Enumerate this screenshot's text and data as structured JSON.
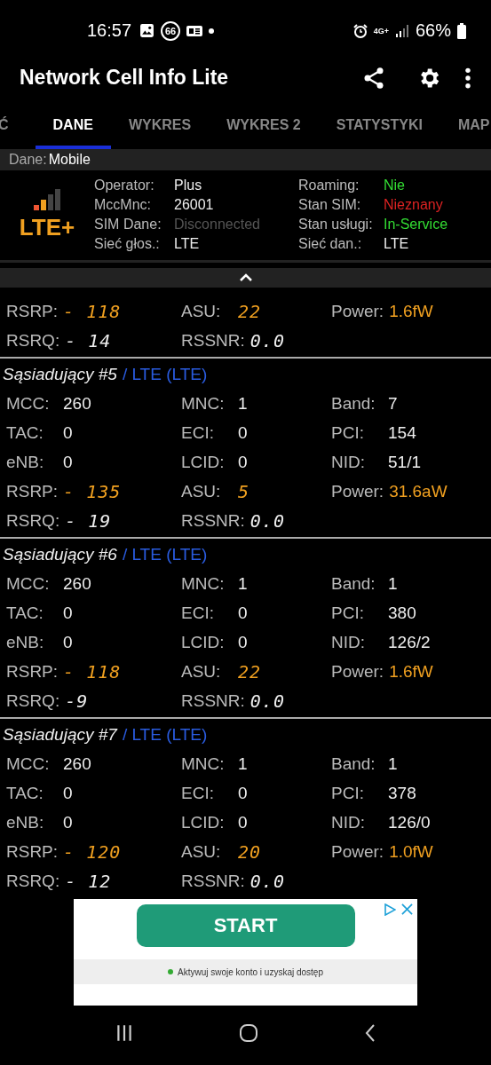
{
  "status_bar": {
    "time": "16:57",
    "badge": "66",
    "network": "4G+",
    "battery": "66%"
  },
  "app_bar": {
    "title": "Network Cell Info Lite"
  },
  "tabs": [
    {
      "label": "Ć",
      "selected": false
    },
    {
      "label": "DANE",
      "selected": true
    },
    {
      "label": "WYKRES",
      "selected": false
    },
    {
      "label": "WYKRES 2",
      "selected": false
    },
    {
      "label": "STATYSTYKI",
      "selected": false
    },
    {
      "label": "MAP",
      "selected": false
    }
  ],
  "data_source": {
    "label": "Dane:",
    "value": "Mobile"
  },
  "summary": {
    "technology": "LTE+",
    "signal": {
      "level": 0.5
    },
    "left": [
      {
        "label": "Operator:",
        "value": "Plus",
        "color": "#eeeeee"
      },
      {
        "label": "MccMnc:",
        "value": "26001",
        "color": "#eeeeee"
      },
      {
        "label": "SIM Dane:",
        "value": "Disconnected",
        "color": "#555555"
      },
      {
        "label": "Sieć głos.:",
        "value": "LTE",
        "color": "#eeeeee"
      }
    ],
    "right": [
      {
        "label": "Roaming:",
        "value": "Nie",
        "color": "#33dd33"
      },
      {
        "label": "Stan SIM:",
        "value": "Nieznany",
        "color": "#dd2222"
      },
      {
        "label": "Stan usługi:",
        "value": "In-Service",
        "color": "#33dd33"
      },
      {
        "label": "Sieć dan.:",
        "value": "LTE",
        "color": "#eeeeee"
      }
    ]
  },
  "cells": [
    {
      "rows": [
        [
          {
            "label": "RSRP:",
            "value": "- 118",
            "kind": "segment",
            "highlight": true
          },
          {
            "label": "ASU:",
            "value": "22",
            "kind": "segment",
            "highlight": true
          },
          {
            "label": "Power:",
            "value": "1.6fW",
            "kind": "power"
          }
        ],
        [
          {
            "label": "RSRQ:",
            "value": "- 14",
            "kind": "segment",
            "highlight": false
          },
          {
            "label": "RSSNR:",
            "value": "0.0",
            "kind": "segment",
            "highlight": false
          }
        ]
      ]
    },
    {
      "title": "Sąsiadujący #5",
      "tech": "/ LTE (LTE)",
      "rows": [
        [
          {
            "label": "MCC:",
            "value": "260",
            "kind": "text"
          },
          {
            "label": "MNC:",
            "value": "1",
            "kind": "text"
          },
          {
            "label": "Band:",
            "value": "7",
            "kind": "text"
          }
        ],
        [
          {
            "label": "TAC:",
            "value": "0",
            "kind": "text"
          },
          {
            "label": "ECI:",
            "value": "0",
            "kind": "text"
          },
          {
            "label": "PCI:",
            "value": "154",
            "kind": "text"
          }
        ],
        [
          {
            "label": "eNB:",
            "value": "0",
            "kind": "text"
          },
          {
            "label": "LCID:",
            "value": "0",
            "kind": "text"
          },
          {
            "label": "NID:",
            "value": "51/1",
            "kind": "text"
          }
        ],
        [
          {
            "label": "RSRP:",
            "value": "- 135",
            "kind": "segment",
            "highlight": true
          },
          {
            "label": "ASU:",
            "value": "5",
            "kind": "segment",
            "highlight": true
          },
          {
            "label": "Power:",
            "value": "31.6aW",
            "kind": "power"
          }
        ],
        [
          {
            "label": "RSRQ:",
            "value": "- 19",
            "kind": "segment",
            "highlight": false
          },
          {
            "label": "RSSNR:",
            "value": "0.0",
            "kind": "segment",
            "highlight": false
          }
        ]
      ]
    },
    {
      "title": "Sąsiadujący #6",
      "tech": "/ LTE (LTE)",
      "rows": [
        [
          {
            "label": "MCC:",
            "value": "260",
            "kind": "text"
          },
          {
            "label": "MNC:",
            "value": "1",
            "kind": "text"
          },
          {
            "label": "Band:",
            "value": "1",
            "kind": "text"
          }
        ],
        [
          {
            "label": "TAC:",
            "value": "0",
            "kind": "text"
          },
          {
            "label": "ECI:",
            "value": "0",
            "kind": "text"
          },
          {
            "label": "PCI:",
            "value": "380",
            "kind": "text"
          }
        ],
        [
          {
            "label": "eNB:",
            "value": "0",
            "kind": "text"
          },
          {
            "label": "LCID:",
            "value": "0",
            "kind": "text"
          },
          {
            "label": "NID:",
            "value": "126/2",
            "kind": "text"
          }
        ],
        [
          {
            "label": "RSRP:",
            "value": "- 118",
            "kind": "segment",
            "highlight": true
          },
          {
            "label": "ASU:",
            "value": "22",
            "kind": "segment",
            "highlight": true
          },
          {
            "label": "Power:",
            "value": "1.6fW",
            "kind": "power"
          }
        ],
        [
          {
            "label": "RSRQ:",
            "value": "-9",
            "kind": "segment",
            "highlight": false
          },
          {
            "label": "RSSNR:",
            "value": "0.0",
            "kind": "segment",
            "highlight": false
          }
        ]
      ]
    },
    {
      "title": "Sąsiadujący #7",
      "tech": "/ LTE (LTE)",
      "rows": [
        [
          {
            "label": "MCC:",
            "value": "260",
            "kind": "text"
          },
          {
            "label": "MNC:",
            "value": "1",
            "kind": "text"
          },
          {
            "label": "Band:",
            "value": "1",
            "kind": "text"
          }
        ],
        [
          {
            "label": "TAC:",
            "value": "0",
            "kind": "text"
          },
          {
            "label": "ECI:",
            "value": "0",
            "kind": "text"
          },
          {
            "label": "PCI:",
            "value": "378",
            "kind": "text"
          }
        ],
        [
          {
            "label": "eNB:",
            "value": "0",
            "kind": "text"
          },
          {
            "label": "LCID:",
            "value": "0",
            "kind": "text"
          },
          {
            "label": "NID:",
            "value": "126/0",
            "kind": "text"
          }
        ],
        [
          {
            "label": "RSRP:",
            "value": "- 120",
            "kind": "segment",
            "highlight": true
          },
          {
            "label": "ASU:",
            "value": "20",
            "kind": "segment",
            "highlight": true
          },
          {
            "label": "Power:",
            "value": "1.0fW",
            "kind": "power"
          }
        ],
        [
          {
            "label": "RSRQ:",
            "value": "- 12",
            "kind": "segment",
            "highlight": false
          },
          {
            "label": "RSSNR:",
            "value": "0.0",
            "kind": "segment",
            "highlight": false
          }
        ]
      ]
    }
  ],
  "ad": {
    "button": "START",
    "caption": "Aktywuj swoje konto i uzyskaj dostęp"
  }
}
